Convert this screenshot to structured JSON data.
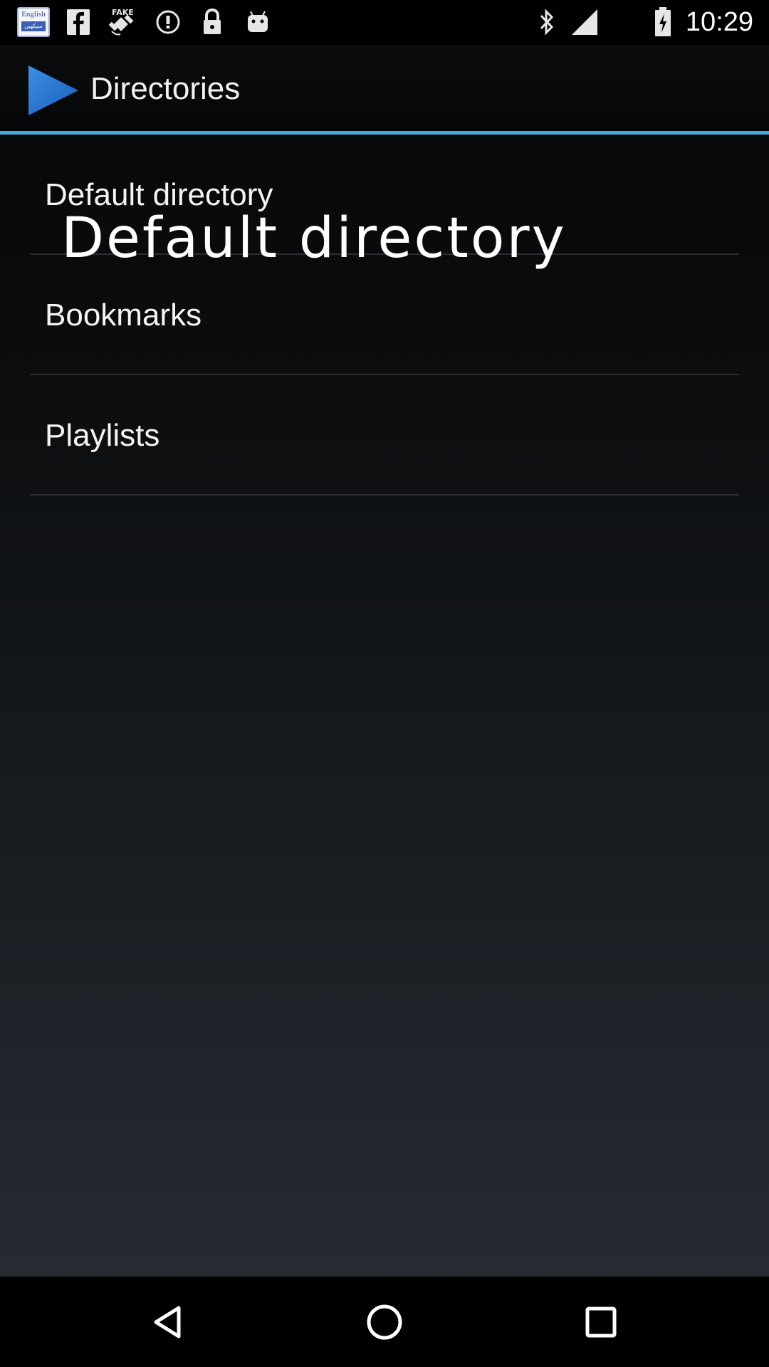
{
  "status_bar": {
    "time": "10:29",
    "keyboard_badge_top": "English",
    "keyboard_badge_bottom": "سیکھیں",
    "icons": [
      "keyboard-language-icon",
      "facebook-icon",
      "fake-gps-icon",
      "info-icon",
      "lock-icon",
      "android-icon",
      "bluetooth-icon",
      "signal-icon",
      "battery-icon"
    ]
  },
  "action_bar": {
    "title": "Directories",
    "app_icon": "play-triangle-icon",
    "accent_color": "#4aa8d8"
  },
  "list": {
    "items": [
      {
        "label": "Default directory"
      },
      {
        "label": "Bookmarks"
      },
      {
        "label": "Playlists"
      }
    ]
  },
  "overlay": {
    "text": "Default directory"
  },
  "nav_bar": {
    "icons": [
      "back-icon",
      "home-icon",
      "recents-icon"
    ]
  }
}
